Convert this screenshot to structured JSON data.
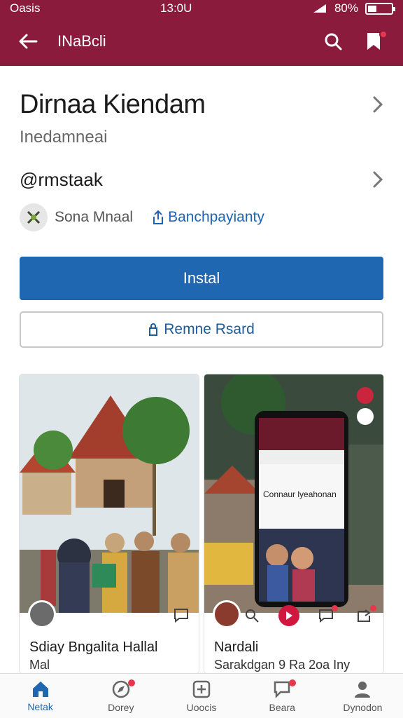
{
  "status": {
    "left": "Oasis",
    "time": "13:0U",
    "battery": "80%"
  },
  "app_bar": {
    "title": "INaBcli"
  },
  "app": {
    "name": "Dirnaa Kiendam",
    "subtitle": "Inedamneai",
    "developer": "@rmstaak",
    "meta_text": "Sona Mnaal",
    "meta_link": "Banchpayianty"
  },
  "buttons": {
    "install": "Instal",
    "secondary": "Remne Rsard"
  },
  "cards": [
    {
      "title": "Sdiay Bngalita Hallal",
      "subtitle": "Mal"
    },
    {
      "title": "Nardali",
      "subtitle": "Sarakdgan 9 Ra 2oa Iny",
      "screen_text": "Connaur lyeahonan"
    }
  ],
  "nav": [
    {
      "label": "Netak",
      "icon": "home-icon",
      "active": true
    },
    {
      "label": "Dorey",
      "icon": "discover-icon",
      "active": false
    },
    {
      "label": "Uoocis",
      "icon": "apps-icon",
      "active": false
    },
    {
      "label": "Beara",
      "icon": "chat-icon",
      "active": false
    },
    {
      "label": "Dynodon",
      "icon": "person-icon",
      "active": false
    }
  ],
  "colors": {
    "brand": "#8a1b3d",
    "primary": "#1f67b0",
    "badge": "#e8364b"
  }
}
